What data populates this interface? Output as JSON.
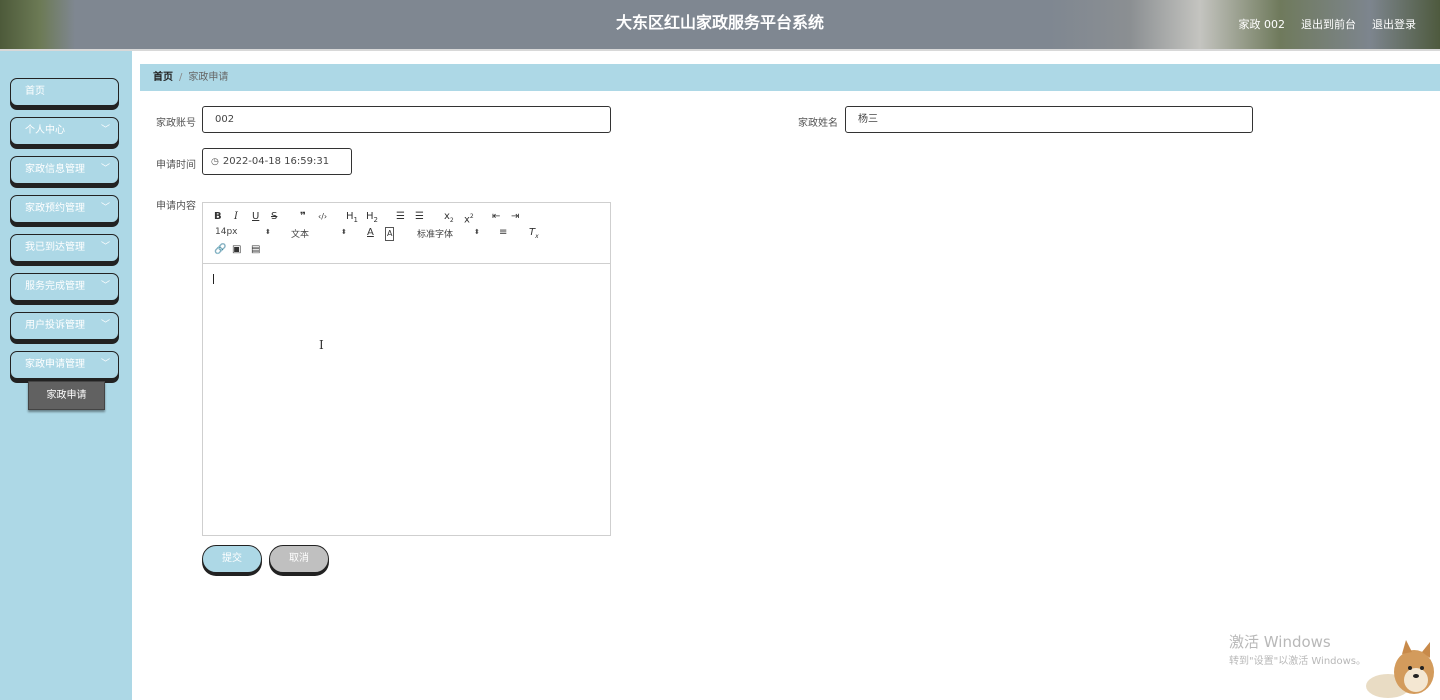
{
  "header": {
    "title": "大东区红山家政服务平台系统",
    "user": "家政 002",
    "to_frontend": "退出到前台",
    "logout": "退出登录"
  },
  "sidebar": {
    "items": [
      {
        "label": "首页",
        "has_chevron": false
      },
      {
        "label": "个人中心",
        "has_chevron": true
      },
      {
        "label": "家政信息管理",
        "has_chevron": true
      },
      {
        "label": "家政预约管理",
        "has_chevron": true
      },
      {
        "label": "我已到达管理",
        "has_chevron": true
      },
      {
        "label": "服务完成管理",
        "has_chevron": true
      },
      {
        "label": "用户投诉管理",
        "has_chevron": true
      },
      {
        "label": "家政申请管理",
        "has_chevron": true
      }
    ],
    "submenu_item": "家政申请",
    "chevron_icon": "chevron-down-icon"
  },
  "breadcrumb": {
    "home": "首页",
    "current": "家政申请"
  },
  "form": {
    "account_label": "家政账号",
    "account_value": "002",
    "name_label": "家政姓名",
    "name_value": "杨三",
    "time_label": "申请时间",
    "time_value": "2022-04-18 16:59:31",
    "content_label": "申请内容"
  },
  "editor": {
    "font_size": "14px",
    "text_type": "文本",
    "font_family": "标准字体",
    "icons": [
      "bold-icon",
      "italic-icon",
      "underline-icon",
      "strike-icon",
      "blockquote-icon",
      "code-icon",
      "h1-icon",
      "h2-icon",
      "ordered-list-icon",
      "bullet-list-icon",
      "subscript-icon",
      "superscript-icon",
      "outdent-icon",
      "indent-icon",
      "font-color-icon",
      "background-color-icon",
      "align-icon",
      "clear-format-icon",
      "link-icon",
      "image-icon",
      "video-icon"
    ]
  },
  "buttons": {
    "submit": "提交",
    "cancel": "取消"
  },
  "watermark": {
    "line1": "激活 Windows",
    "line2": "转到\"设置\"以激活 Windows。"
  },
  "colors": {
    "accent": "#add8e6",
    "submenu_bg": "#616161",
    "cancel_bg": "#c0c0c0"
  }
}
